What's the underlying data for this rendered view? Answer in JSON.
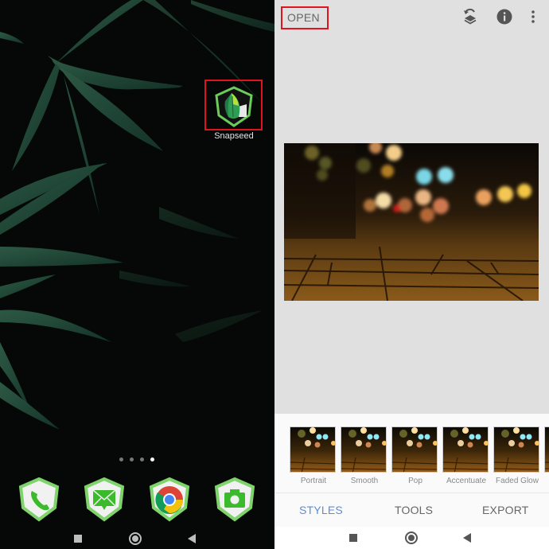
{
  "home_screen": {
    "app": {
      "name": "Snapseed",
      "icon": "snapseed-leaf-icon",
      "highlighted": true
    },
    "page_indicator": {
      "count": 4,
      "active_index": 3
    },
    "dock": [
      {
        "name": "Phone",
        "icon": "phone-icon"
      },
      {
        "name": "Messages",
        "icon": "message-envelope-icon"
      },
      {
        "name": "Chrome",
        "icon": "chrome-icon"
      },
      {
        "name": "Camera",
        "icon": "camera-icon"
      }
    ],
    "navbar": [
      "recents",
      "home",
      "back"
    ]
  },
  "snapseed": {
    "toolbar": {
      "open_label": "OPEN",
      "open_highlighted": true,
      "icons": [
        "layers-undo-icon",
        "info-icon",
        "more-vert-icon"
      ]
    },
    "photo": {
      "subject": "night street bokeh lights over brick pavement"
    },
    "styles": [
      {
        "label": "Portrait"
      },
      {
        "label": "Smooth"
      },
      {
        "label": "Pop"
      },
      {
        "label": "Accentuate"
      },
      {
        "label": "Faded Glow"
      }
    ],
    "tabs": [
      {
        "label": "STYLES",
        "active": true
      },
      {
        "label": "TOOLS",
        "active": false
      },
      {
        "label": "EXPORT",
        "active": false
      }
    ],
    "colors": {
      "active_tab": "#5b8dd9",
      "highlight_box": "#e0141e",
      "background": "#e0e0e0"
    }
  }
}
